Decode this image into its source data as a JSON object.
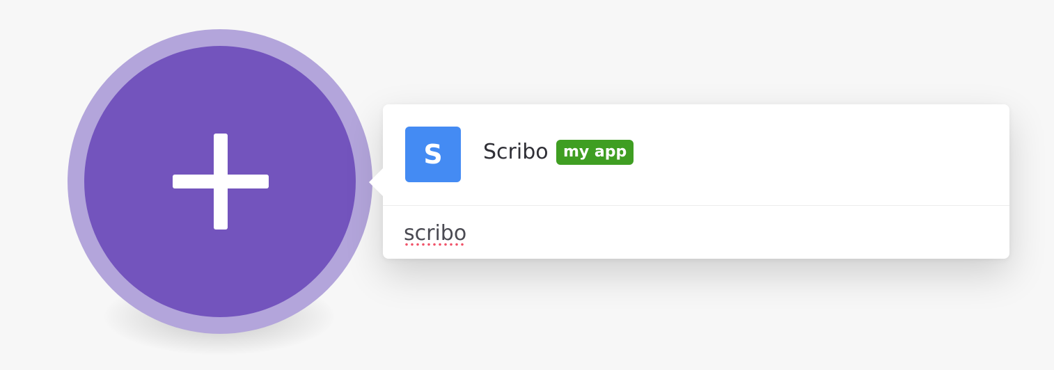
{
  "add_module": {
    "icon": "plus-icon"
  },
  "search": {
    "value": "scribo",
    "placeholder": ""
  },
  "results": [
    {
      "name": "Scribo",
      "icon_letter": "S",
      "icon": "scribo-app-icon",
      "badge": "my app"
    }
  ],
  "colors": {
    "module_outer": "#b3a5db",
    "module_inner": "#7354bd",
    "app_icon_bg": "#448bf3",
    "badge_bg": "#3f9e22",
    "spellcheck": "#f0546a"
  }
}
